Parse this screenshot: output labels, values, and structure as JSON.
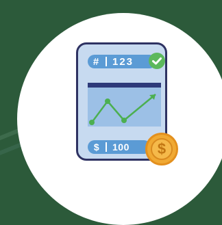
{
  "card": {
    "top_symbol": "#",
    "top_value": "123",
    "bottom_symbol": "$",
    "bottom_value": "100"
  },
  "coin": {
    "symbol": "$"
  },
  "icons": [
    "check-icon",
    "line-chart-icon",
    "dollar-coin-icon"
  ],
  "colors": {
    "background": "#2c5a3a",
    "card": "#c7daf0",
    "card_border": "#2e3262",
    "pill": "#5b9bd5",
    "check": "#5cb85c",
    "chart_line": "#4caf50",
    "coin": "#f0a933"
  }
}
